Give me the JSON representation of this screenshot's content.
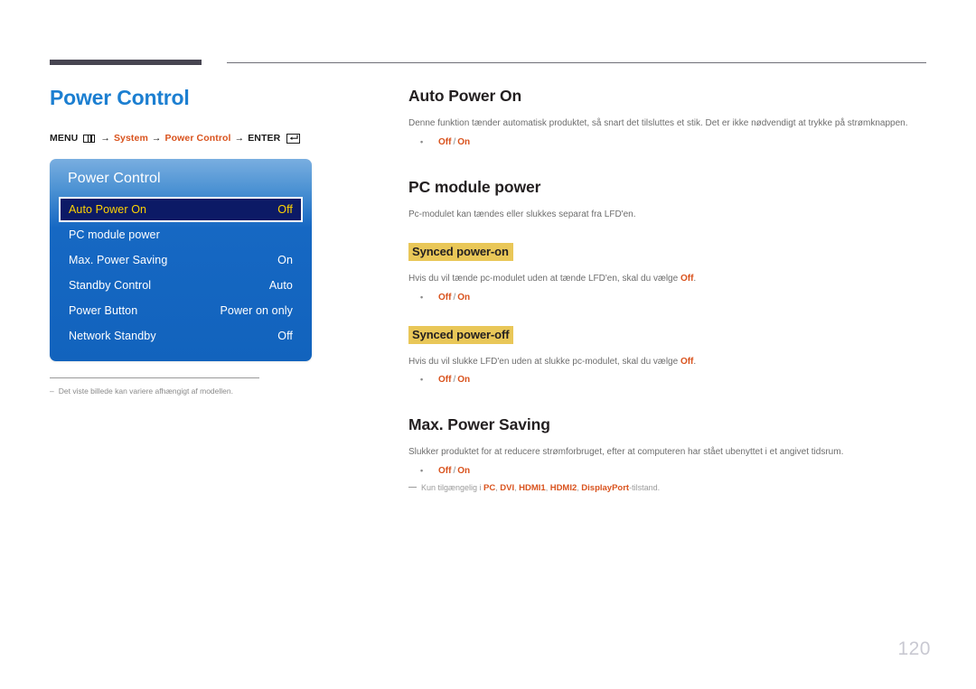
{
  "page": {
    "number": "120"
  },
  "left": {
    "title": "Power Control",
    "breadcrumb": {
      "menu_label": "MENU",
      "menu_icon": "menu-grid-icon",
      "arrow": "→",
      "crumb1": "System",
      "crumb2": "Power Control",
      "enter_label": "ENTER",
      "enter_icon": "enter-key-icon"
    },
    "osd": {
      "title": "Power Control",
      "rows": [
        {
          "label": "Auto Power On",
          "value": "Off",
          "selected": true
        },
        {
          "label": "PC module power",
          "value": "",
          "selected": false
        },
        {
          "label": "Max. Power Saving",
          "value": "On",
          "selected": false
        },
        {
          "label": "Standby Control",
          "value": "Auto",
          "selected": false
        },
        {
          "label": "Power Button",
          "value": "Power on only",
          "selected": false
        },
        {
          "label": "Network Standby",
          "value": "Off",
          "selected": false
        }
      ]
    },
    "note": {
      "dash": "–",
      "text": "Det viste billede kan variere afhængigt af modellen."
    }
  },
  "right": {
    "sections": [
      {
        "heading": "Auto Power On",
        "paragraph": "Denne funktion tænder automatisk produktet, så snart det tilsluttes et stik. Det er ikke nødvendigt at trykke på strømknappen.",
        "bullet": {
          "dot": "•",
          "off": "Off",
          "slash": "/",
          "on": "On"
        }
      },
      {
        "heading": "PC module power",
        "paragraph": "Pc-modulet kan tændes eller slukkes separat fra LFD'en."
      },
      {
        "highlight": "Synced power-on",
        "paragraph_pre": "Hvis du vil tænde pc-modulet uden at tænde LFD'en, skal du vælge ",
        "paragraph_accent": "Off",
        "paragraph_post": ".",
        "bullet": {
          "dot": "•",
          "off": "Off",
          "slash": "/",
          "on": "On"
        }
      },
      {
        "highlight": "Synced power-off",
        "paragraph_pre": "Hvis du vil slukke LFD'en uden at slukke pc-modulet, skal du vælge ",
        "paragraph_accent": "Off",
        "paragraph_post": ".",
        "bullet": {
          "dot": "•",
          "off": "Off",
          "slash": "/",
          "on": "On"
        }
      },
      {
        "heading": "Max. Power Saving",
        "paragraph": "Slukker produktet for at reducere strømforbruget, efter at computeren har stået ubenyttet i et angivet tidsrum.",
        "bullet": {
          "dot": "•",
          "off": "Off",
          "slash": "/",
          "on": "On"
        },
        "footnote": {
          "pre": "Kun tilgængelig i ",
          "inputs": [
            "PC",
            "DVI",
            "HDMI1",
            "HDMI2",
            "DisplayPort"
          ],
          "post": "-tilstand."
        }
      }
    ]
  },
  "colors": {
    "title_blue": "#1c7fd1",
    "accent_orange": "#d9531e",
    "highlight_yellow": "#e9c758",
    "osd_blue": "#1668c3",
    "osd_selected_navy": "#0c1a66",
    "osd_selected_text": "#ffd400",
    "rule_dark": "#474551"
  }
}
